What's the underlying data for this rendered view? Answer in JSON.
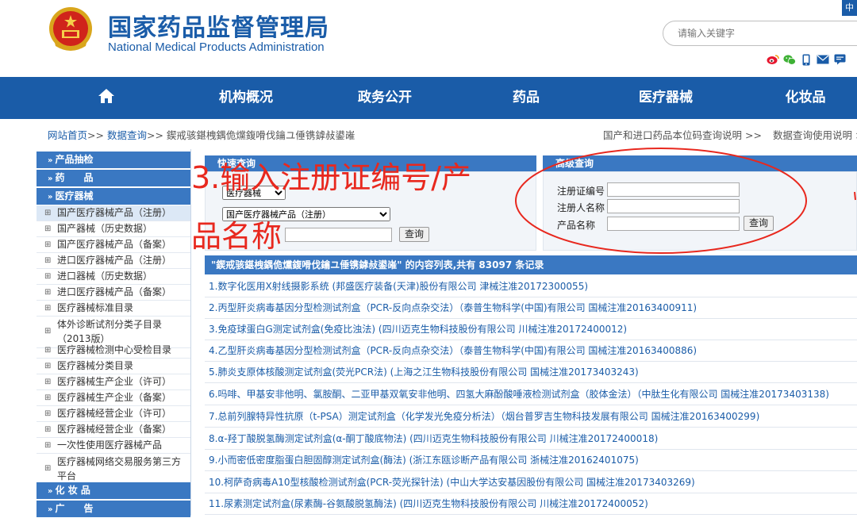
{
  "header": {
    "title": "国家药品监督管理局",
    "subtitle": "National Medical Products Administration",
    "lang_badge": "中",
    "search_placeholder": "请输入关键字",
    "share_icons": [
      "weibo-icon",
      "wechat-icon",
      "mobile-icon",
      "mail-icon",
      "feedback-icon"
    ]
  },
  "nav": {
    "home_icon": "home-icon",
    "items": [
      "机构概况",
      "政务公开",
      "药品",
      "医疗器械",
      "化妆品"
    ]
  },
  "breadcrumb": {
    "home": "网站首页",
    "sep1": ">>",
    "query": "数据查询",
    "sep2": ">>",
    "current": "鍥戒骇鍖栧鍝佹爣鍑嗗伐鑰ユ倕镌鎼敊鍙嶉",
    "right_link": "国产和进口药品本位码查询说明",
    "right_sep": ">>",
    "right_link2": "数据查询使用说明",
    "right_sep2": ">"
  },
  "sidebar": {
    "headers": [
      "产品抽检",
      "药　　品",
      "医疗器械",
      "化 妆 品",
      "广　　告"
    ],
    "items": [
      "国产医疗器械产品（注册）",
      "国产器械（历史数据）",
      "国产医疗器械产品（备案）",
      "进口医疗器械产品（注册）",
      "进口器械（历史数据）",
      "进口医疗器械产品（备案）",
      "医疗器械标准目录",
      "体外诊断试剂分类子目录（2013版）",
      "医疗器械检测中心受检目录",
      "医疗器械分类目录",
      "医疗器械生产企业（许可）",
      "医疗器械生产企业（备案）",
      "医疗器械经营企业（许可）",
      "医疗器械经营企业（备案）",
      "一次性使用医疗器械产品",
      "医疗器械网络交易服务第三方平台"
    ]
  },
  "quick_query": {
    "title": "快速查询",
    "category_selected": "医疗器械",
    "database_selected": "国产医疗器械产品（注册）",
    "keyword_value": "",
    "button": "查询"
  },
  "advanced_query": {
    "title": "高级查询",
    "fields": [
      "注册证编号",
      "注册人名称",
      "产品名称"
    ],
    "button": "查询"
  },
  "results": {
    "header": "\"鍥戒骇鍖栧鍝佹爣鍑嗗伐鑰ユ倕镌鎼敊鍙嶉\" 的内容列表,共有 83097 条记录",
    "rows": [
      "1.数字化医用X射线摄影系统 (邦盛医疗装备(天津)股份有限公司 津械注准20172300055)",
      "2.丙型肝炎病毒基因分型检测试剂盒（PCR-反向点杂交法）（泰普生物科学(中国)有限公司 国械注准20163400911)",
      "3.免疫球蛋白G测定试剂盒(免疫比浊法) (四川迈克生物科技股份有限公司 川械注准20172400012)",
      "4.乙型肝炎病毒基因分型检测试剂盒（PCR-反向点杂交法）（泰普生物科学(中国)有限公司 国械注准20163400886)",
      "5.肺炎支原体核酸测定试剂盒(荧光PCR法) (上海之江生物科技股份有限公司 国械注准20173403243)",
      "6.吗啡、甲基安非他明、氯胺酮、二亚甲基双氧安非他明、四氢大麻酚酸唾液检测试剂盒（胶体金法）（中肽生化有限公司 国械注准20173403138)",
      "7.总前列腺特异性抗原（t-PSA）测定试剂盒（化学发光免疫分析法）（烟台普罗吉生物科技发展有限公司 国械注准20163400299)",
      "8.α-羟丁酸脱氢酶测定试剂盒(α-酮丁酸底物法) (四川迈克生物科技股份有限公司 川械注准20172400018)",
      "9.小而密低密度脂蛋白胆固醇测定试剂盒(酶法) (浙江东瓯诊断产品有限公司 浙械注准20162401075)",
      "10.柯萨奇病毒A10型核酸检测试剂盒(PCR-荧光探针法) (中山大学达安基因股份有限公司 国械注准20173403269)",
      "11.尿素测定试剂盒(尿素酶-谷氨酸脱氢酶法) (四川迈克生物科技股份有限公司 川械注准20172400052)"
    ]
  },
  "annotation": {
    "line1": "3.输入注册证编号/产",
    "line2": "品名称",
    "color": "#e8281e"
  },
  "colors": {
    "brand_blue": "#1a5ca8",
    "panel_blue": "#3a78c2",
    "annotation_red": "#e8281e"
  }
}
